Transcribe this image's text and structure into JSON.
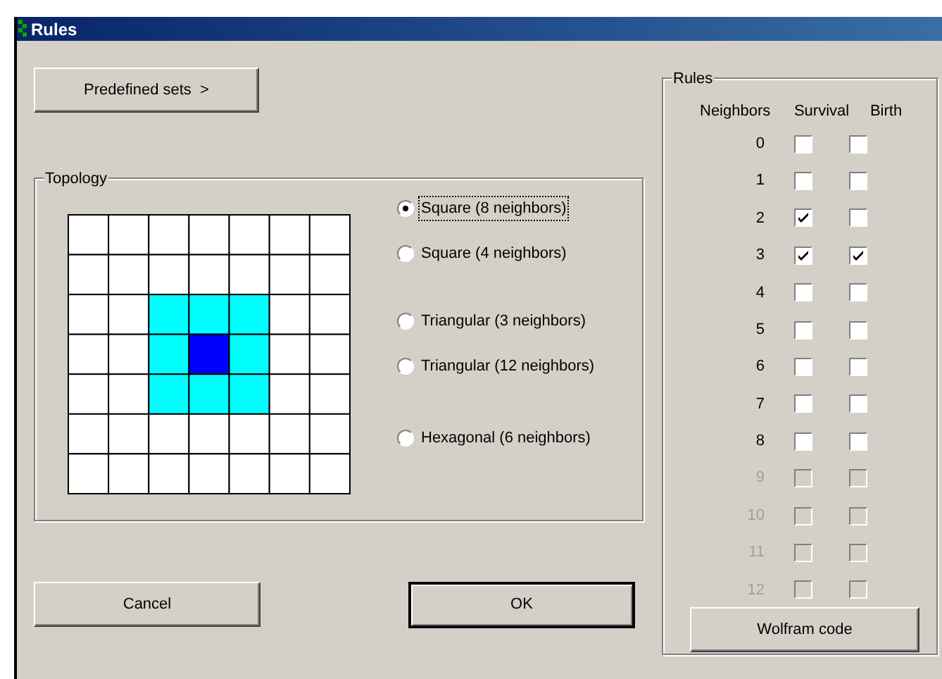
{
  "window": {
    "title": "Rules"
  },
  "predefined_button": "Predefined sets  >",
  "topology": {
    "title": "Topology",
    "options": [
      {
        "label": "Square (8 neighbors)",
        "selected": true
      },
      {
        "label": "Square (4 neighbors)",
        "selected": false
      },
      {
        "label": "Triangular (3 neighbors)",
        "selected": false
      },
      {
        "label": "Triangular (12 neighbors)",
        "selected": false
      },
      {
        "label": "Hexagonal (6 neighbors)",
        "selected": false
      }
    ]
  },
  "buttons": [
    "Cancel",
    "OK"
  ],
  "rules": {
    "title": "Rules",
    "columns": [
      "Neighbors",
      "Survival",
      "Birth"
    ],
    "rows": [
      {
        "neighbors": "0",
        "survival": false,
        "birth": false,
        "disabled": false
      },
      {
        "neighbors": "1",
        "survival": false,
        "birth": false,
        "disabled": false
      },
      {
        "neighbors": "2",
        "survival": true,
        "birth": false,
        "disabled": false
      },
      {
        "neighbors": "3",
        "survival": true,
        "birth": true,
        "disabled": false
      },
      {
        "neighbors": "4",
        "survival": false,
        "birth": false,
        "disabled": false
      },
      {
        "neighbors": "5",
        "survival": false,
        "birth": false,
        "disabled": false
      },
      {
        "neighbors": "6",
        "survival": false,
        "birth": false,
        "disabled": false
      },
      {
        "neighbors": "7",
        "survival": false,
        "birth": false,
        "disabled": false
      },
      {
        "neighbors": "8",
        "survival": false,
        "birth": false,
        "disabled": false
      },
      {
        "neighbors": "9",
        "survival": false,
        "birth": false,
        "disabled": true
      },
      {
        "neighbors": "10",
        "survival": false,
        "birth": false,
        "disabled": true
      },
      {
        "neighbors": "11",
        "survival": false,
        "birth": false,
        "disabled": true
      },
      {
        "neighbors": "12",
        "survival": false,
        "birth": false,
        "disabled": true
      }
    ],
    "wolfram_button": "Wolfram code"
  }
}
